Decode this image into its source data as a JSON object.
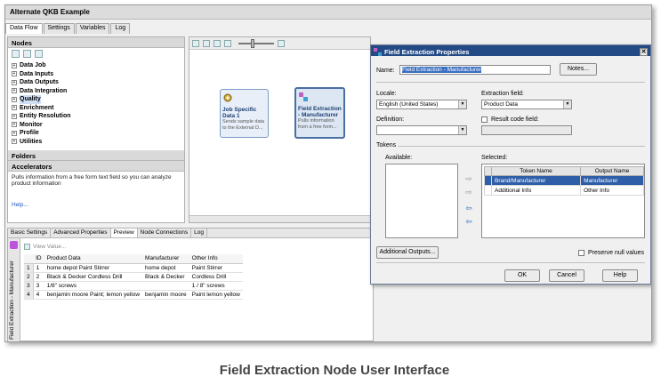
{
  "window": {
    "title": "Alternate QKB Example"
  },
  "tabs": [
    {
      "label": "Data Flow"
    },
    {
      "label": "Settings"
    },
    {
      "label": "Variables"
    },
    {
      "label": "Log"
    }
  ],
  "nodes_panel": {
    "header": "Nodes",
    "items": [
      {
        "label": "Data Job"
      },
      {
        "label": "Data Inputs"
      },
      {
        "label": "Data Outputs"
      },
      {
        "label": "Data Integration"
      },
      {
        "label": "Quality"
      },
      {
        "label": "Enrichment"
      },
      {
        "label": "Entity Resolution"
      },
      {
        "label": "Monitor"
      },
      {
        "label": "Profile"
      },
      {
        "label": "Utilities"
      }
    ],
    "folders": "Folders",
    "accelerators": "Accelerators",
    "description": "Pulls information from a free form text field so you can analyze product information",
    "help": "Help..."
  },
  "canvas": {
    "nodes": [
      {
        "title": "Job Specific Data 1",
        "desc": "Sends sample data to the External D..."
      },
      {
        "title": "Field Extraction - Manufacturer",
        "desc": "Pulls information from a free form..."
      }
    ]
  },
  "bottom": {
    "tabs": [
      {
        "label": "Basic Settings"
      },
      {
        "label": "Advanced Properties"
      },
      {
        "label": "Preview"
      },
      {
        "label": "Node Connections"
      },
      {
        "label": "Log"
      }
    ],
    "side_label": "Field Extraction - Manufacturer",
    "view_value": "View Value...",
    "columns": [
      "ID",
      "Product Data",
      "Manufacturer",
      "Other Info"
    ],
    "rows": [
      {
        "n": "1",
        "id": "1",
        "product": "home depot Paint Stirrer",
        "manufacturer": "home depot",
        "other": "Paint Stirrer"
      },
      {
        "n": "2",
        "id": "2",
        "product": "Black & Decker Cordless Drill",
        "manufacturer": "Black & Decker",
        "other": "Cordless Drill"
      },
      {
        "n": "3",
        "id": "3",
        "product": "1/8\" screws",
        "manufacturer": "",
        "other": "1 / 8\" screws"
      },
      {
        "n": "4",
        "id": "4",
        "product": "benjamin moore Paint; lemon yellow",
        "manufacturer": "benjamin moore",
        "other": "Paint lemon yellow"
      }
    ]
  },
  "dialog": {
    "title": "Field Extraction Properties",
    "name_label": "Name:",
    "name_value": "Field Extraction - Manufacturer",
    "notes_button": "Notes...",
    "locale_label": "Locale:",
    "locale_value": "English (United States)",
    "extraction_label": "Extraction field:",
    "extraction_value": "Product Data",
    "definition_label": "Definition:",
    "definition_value": "",
    "result_code_label": "Result code field:",
    "tokens_label": "Tokens",
    "available_label": "Available:",
    "selected_label": "Selected:",
    "selected_columns": [
      "Token Name",
      "Output Name"
    ],
    "selected_rows": [
      {
        "token": "Brand/Manufacturer",
        "output": "Manufacturer"
      },
      {
        "token": "Additional Info",
        "output": "Other Info"
      }
    ],
    "additional_outputs": "Additional Outputs...",
    "preserve_nulls": "Preserve null values",
    "ok": "OK",
    "cancel": "Cancel",
    "help": "Help"
  },
  "caption": "Field Extraction Node User Interface",
  "colors": {
    "dialog_title": "#244a86",
    "selection": "#2e5ea8"
  }
}
